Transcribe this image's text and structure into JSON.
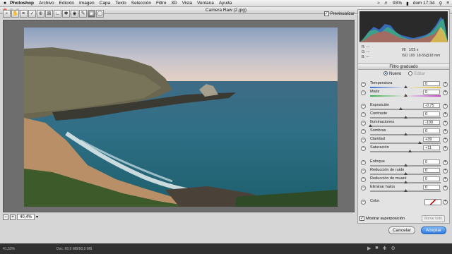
{
  "menubar": {
    "app": "Photoshop",
    "items": [
      "Archivo",
      "Edición",
      "Imagen",
      "Capa",
      "Texto",
      "Selección",
      "Filtro",
      "3D",
      "Vista",
      "Ventana",
      "Ayuda"
    ],
    "battery": "93%",
    "clock": "dom 17:34"
  },
  "window": {
    "title": "Camera Raw (2.jpg)"
  },
  "toolbar": {
    "preview_label": "Previsualizar"
  },
  "status": {
    "zoom": "40,4%"
  },
  "meta": {
    "r": "R:",
    "g": "G:",
    "b": "B:",
    "dash": "---",
    "aperture": "f/8",
    "shutter": "1/25 s",
    "iso": "ISO 100",
    "lens": "18-55@18 mm"
  },
  "panel": {
    "title": "Filtro graduado",
    "mode_new": "Nuevo",
    "mode_edit": "Editar",
    "sliders": [
      {
        "label": "Temperatura",
        "value": "0"
      },
      {
        "label": "Matiz",
        "value": "0"
      },
      {
        "label": "Exposición",
        "value": "-0,75"
      },
      {
        "label": "Contraste",
        "value": "0"
      },
      {
        "label": "Iluminaciones",
        "value": "-100"
      },
      {
        "label": "Sombras",
        "value": "0"
      },
      {
        "label": "Claridad",
        "value": "+39"
      },
      {
        "label": "Saturación",
        "value": "+11"
      },
      {
        "label": "Enfoque",
        "value": "0"
      },
      {
        "label": "Reducción de ruido",
        "value": "0"
      },
      {
        "label": "Reducción de muaré",
        "value": "0"
      },
      {
        "label": "Eliminar halos",
        "value": "0"
      }
    ],
    "color_label": "Color",
    "overlay_label": "Mostrar superposición",
    "clear_all": "Borrar todo"
  },
  "buttons": {
    "cancel": "Cancelar",
    "ok": "Aceptar"
  },
  "ps_status": {
    "zoom": "41,53%",
    "doc": "Doc: 60,0 MB/60,0 MB"
  }
}
